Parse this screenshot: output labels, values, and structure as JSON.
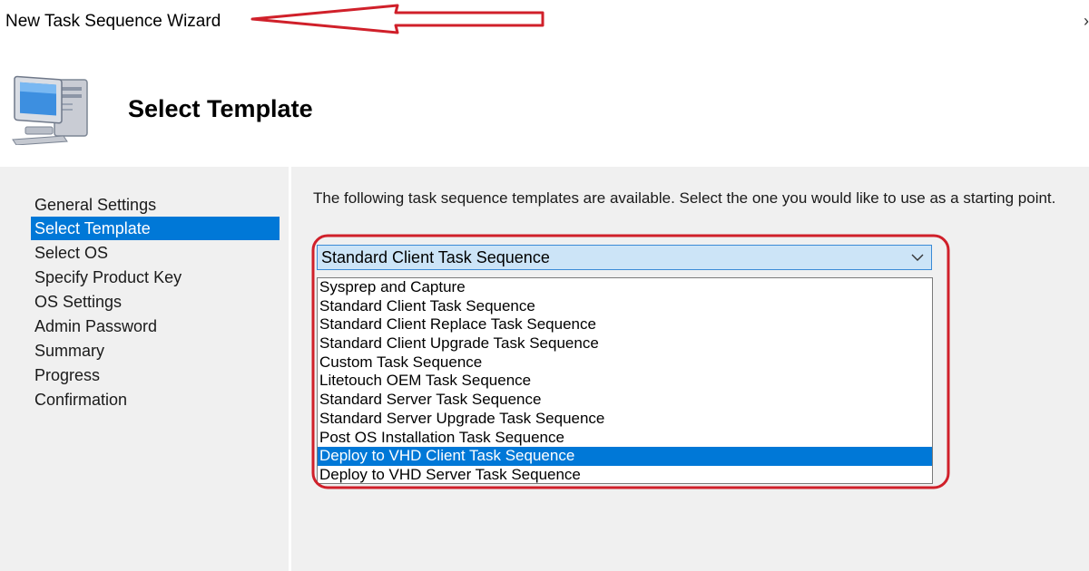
{
  "window": {
    "title": "New Task Sequence Wizard",
    "close_glyph": "›"
  },
  "header": {
    "title": "Select Template",
    "icon": "computer-icon"
  },
  "sidebar": {
    "items": [
      {
        "label": "General Settings",
        "selected": false
      },
      {
        "label": "Select Template",
        "selected": true
      },
      {
        "label": "Select OS",
        "selected": false
      },
      {
        "label": "Specify Product Key",
        "selected": false
      },
      {
        "label": "OS Settings",
        "selected": false
      },
      {
        "label": "Admin Password",
        "selected": false
      },
      {
        "label": "Summary",
        "selected": false
      },
      {
        "label": "Progress",
        "selected": false
      },
      {
        "label": "Confirmation",
        "selected": false
      }
    ]
  },
  "main": {
    "instructions": "The following task sequence templates are available.  Select the one you would like to use as a starting point.",
    "template_select": {
      "value": "Standard Client Task Sequence",
      "options": [
        {
          "label": "Sysprep and Capture",
          "highlighted": false
        },
        {
          "label": "Standard Client Task Sequence",
          "highlighted": false
        },
        {
          "label": "Standard Client Replace Task Sequence",
          "highlighted": false
        },
        {
          "label": "Standard Client Upgrade Task Sequence",
          "highlighted": false
        },
        {
          "label": "Custom Task Sequence",
          "highlighted": false
        },
        {
          "label": "Litetouch OEM Task Sequence",
          "highlighted": false
        },
        {
          "label": "Standard Server Task Sequence",
          "highlighted": false
        },
        {
          "label": "Standard Server Upgrade Task Sequence",
          "highlighted": false
        },
        {
          "label": "Post OS Installation Task Sequence",
          "highlighted": false
        },
        {
          "label": "Deploy to VHD Client Task Sequence",
          "highlighted": true
        },
        {
          "label": "Deploy to VHD Server Task Sequence",
          "highlighted": false
        }
      ]
    }
  },
  "colors": {
    "selection": "#0078d7",
    "annotation": "#d0202a",
    "panel_bg": "#f0f0f0",
    "combo_bg": "#cce4f7"
  }
}
